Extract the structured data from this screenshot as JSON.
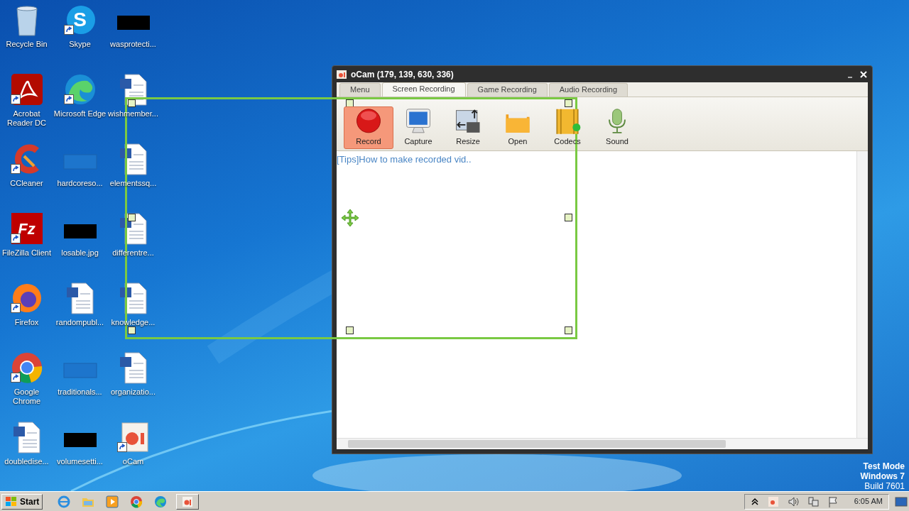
{
  "desktop": {
    "icons": [
      {
        "label": "Recycle Bin",
        "kind": "recycle",
        "shortcut": false
      },
      {
        "label": "Acrobat Reader DC",
        "kind": "pdf",
        "shortcut": true
      },
      {
        "label": "CCleaner",
        "kind": "ccleaner",
        "shortcut": true
      },
      {
        "label": "FileZilla Client",
        "kind": "filezilla",
        "shortcut": true,
        "glyph": "Fz"
      },
      {
        "label": "Firefox",
        "kind": "firefox",
        "shortcut": true
      },
      {
        "label": "Google Chrome",
        "kind": "chrome",
        "shortcut": true
      },
      {
        "label": "doubledise...",
        "kind": "doc",
        "shortcut": false
      },
      {
        "label": "Skype",
        "kind": "skype",
        "shortcut": true,
        "glyph": "S"
      },
      {
        "label": "Microsoft Edge",
        "kind": "edge",
        "shortcut": true
      },
      {
        "label": "hardcoreso...",
        "kind": "blank",
        "shortcut": false
      },
      {
        "label": "losable.jpg",
        "kind": "black",
        "shortcut": false
      },
      {
        "label": "randompubl...",
        "kind": "doc",
        "shortcut": false
      },
      {
        "label": "traditionals...",
        "kind": "blank",
        "shortcut": false
      },
      {
        "label": "volumesetti...",
        "kind": "black",
        "shortcut": false
      },
      {
        "label": "wasprotecti...",
        "kind": "black",
        "shortcut": false
      },
      {
        "label": "wishmember...",
        "kind": "doc",
        "shortcut": false
      },
      {
        "label": "elementssq...",
        "kind": "doc",
        "shortcut": false
      },
      {
        "label": "differentre...",
        "kind": "doc",
        "shortcut": false
      },
      {
        "label": "knowledge...",
        "kind": "doc",
        "shortcut": false
      },
      {
        "label": "organizatio...",
        "kind": "doc",
        "shortcut": false
      },
      {
        "label": "oCam",
        "kind": "ocam",
        "shortcut": true
      }
    ]
  },
  "window": {
    "title": "oCam (179, 139, 630, 336)",
    "tabs": [
      {
        "label": "Menu",
        "selected": false
      },
      {
        "label": "Screen Recording",
        "selected": true
      },
      {
        "label": "Game Recording",
        "selected": false
      },
      {
        "label": "Audio Recording",
        "selected": false
      }
    ],
    "tools": [
      {
        "label": "Record",
        "kind": "record",
        "selected": true
      },
      {
        "label": "Capture",
        "kind": "capture",
        "selected": false
      },
      {
        "label": "Resize",
        "kind": "resize",
        "selected": false
      },
      {
        "label": "Open",
        "kind": "open",
        "selected": false
      },
      {
        "label": "Codecs",
        "kind": "codecs",
        "selected": false
      },
      {
        "label": "Sound",
        "kind": "sound",
        "selected": false
      }
    ],
    "tip_link": "[Tips]How to make recorded vid.."
  },
  "os_notice": [
    "Test Mode",
    "Windows 7",
    "Build 7601"
  ],
  "taskbar": {
    "start": "Start",
    "pinned": [
      {
        "kind": "ie",
        "active": false
      },
      {
        "kind": "folder",
        "active": false
      },
      {
        "kind": "media",
        "active": false
      },
      {
        "kind": "chrome",
        "active": false
      },
      {
        "kind": "edge",
        "active": false
      },
      {
        "kind": "ocam",
        "active": true
      }
    ],
    "tray": [
      {
        "kind": "chevron"
      },
      {
        "kind": "ocam"
      },
      {
        "kind": "speaker"
      },
      {
        "kind": "network"
      },
      {
        "kind": "flag"
      }
    ],
    "clock": "6:05 AM"
  }
}
